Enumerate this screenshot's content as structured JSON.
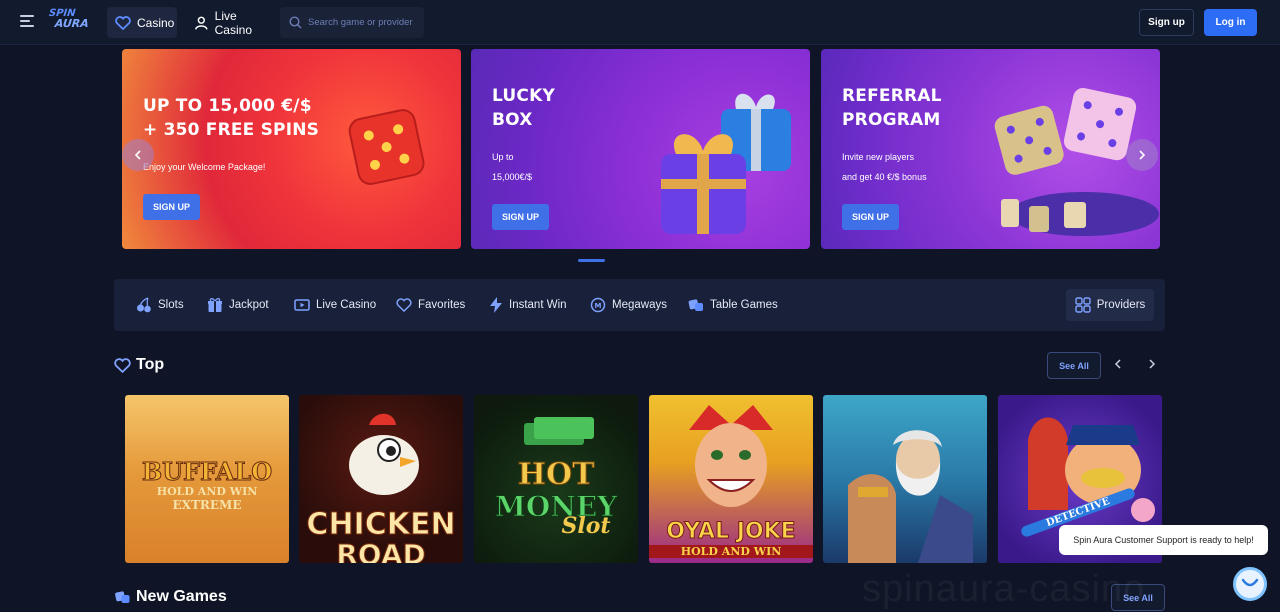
{
  "header": {
    "logo_line1": "SPIN",
    "logo_line2": "AURA",
    "nav": {
      "casino": "Casino",
      "live_casino": "Live Casino"
    },
    "search_placeholder": "Search game or provider",
    "signup": "Sign up",
    "login": "Log in"
  },
  "banners": [
    {
      "title_line1": "UP TO 15,000 €/$",
      "title_line2": "+ 350 FREE SPINS",
      "text1": "Enjoy your Welcome Package!",
      "text2": "",
      "button": "SIGN UP"
    },
    {
      "title_line1": "LUCKY",
      "title_line2": "BOX",
      "text1": "Up to",
      "text2": "15,000€/$",
      "button": "SIGN UP"
    },
    {
      "title_line1": "REFERRAL",
      "title_line2": "PROGRAM",
      "text1": "Invite new players",
      "text2": "and get 40 €/$ bonus",
      "button": "SIGN UP"
    }
  ],
  "categories": [
    "Slots",
    "Jackpot",
    "Live Casino",
    "Favorites",
    "Instant Win",
    "Megaways",
    "Table Games"
  ],
  "providers": "Providers",
  "top": {
    "title": "Top",
    "see_all": "See All",
    "games": [
      {
        "line1": "BUFFALO",
        "line2": "HOLD AND WIN",
        "line3": "EXTREME"
      },
      {
        "line1": "CHICKEN",
        "line2": "ROAD",
        "line3": ""
      },
      {
        "line1": "HOT",
        "line2": "MONEY",
        "line3": "Slot"
      },
      {
        "line1": "OYAL JOKE",
        "line2": "HOLD AND WIN",
        "line3": ""
      },
      {
        "line1": "",
        "line2": "",
        "line3": ""
      },
      {
        "line1": "DETECTIVE",
        "line2": "",
        "line3": ""
      }
    ]
  },
  "new_games": {
    "title": "New Games",
    "see_all": "See All"
  },
  "support_message": "Spin Aura Customer Support is ready to help!",
  "watermark": "spinaura-casino",
  "colors": {
    "background": "#0f1526",
    "accent": "#2d6df6",
    "panel": "#18203a"
  }
}
